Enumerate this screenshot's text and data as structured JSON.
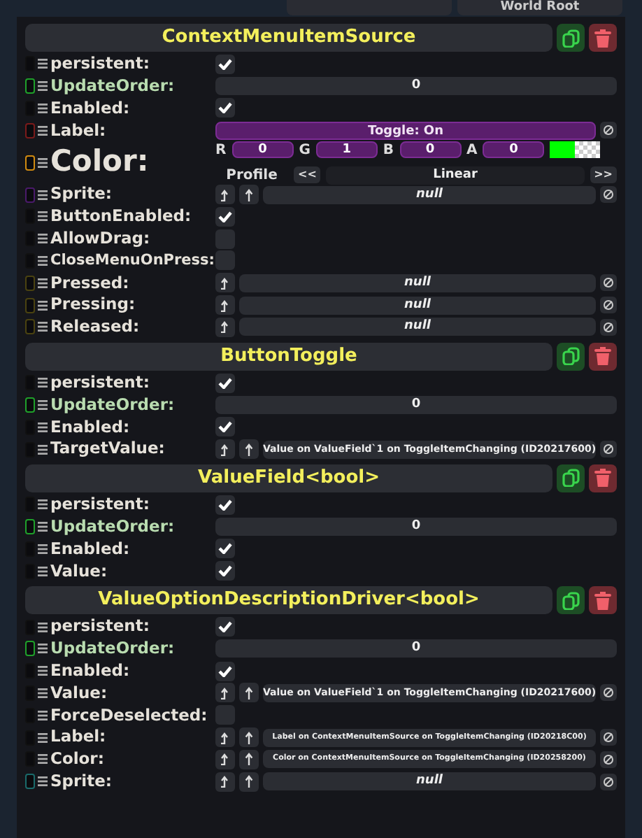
{
  "top_bar": {
    "right_label": "World Root"
  },
  "components": [
    {
      "title": "ContextMenuItemSource",
      "fields": [
        {
          "name": "persistent:",
          "color": "#111111",
          "kind": "check",
          "checked": true
        },
        {
          "name": "UpdateOrder:",
          "color": "#1fa02a",
          "kind": "number",
          "value": "0"
        },
        {
          "name": "Enabled:",
          "color": "#111111",
          "kind": "check",
          "checked": true
        },
        {
          "name": "Label:",
          "color": "#7a1a1a",
          "kind": "text",
          "value": "Toggle: On"
        },
        {
          "name": "Color:",
          "color": "#d08a10",
          "kind": "color",
          "channels": [
            {
              "label": "R",
              "value": "0"
            },
            {
              "label": "G",
              "value": "1"
            },
            {
              "label": "B",
              "value": "0"
            },
            {
              "label": "A",
              "value": "0"
            }
          ],
          "swatch": {
            "color": "#00ff00"
          },
          "profile_label": "Profile",
          "prev": "<<",
          "profile": "Linear",
          "next": ">>"
        },
        {
          "name": "Sprite:",
          "color": "#4a1a6a",
          "kind": "ref",
          "value": "null",
          "is_null": true
        },
        {
          "name": "ButtonEnabled:",
          "color": "#111111",
          "kind": "check",
          "checked": true
        },
        {
          "name": "AllowDrag:",
          "color": "#111111",
          "kind": "check",
          "checked": false
        },
        {
          "name": "CloseMenuOnPress:",
          "color": "#111111",
          "kind": "check",
          "checked": false
        },
        {
          "name": "Pressed:",
          "color": "#4a4210",
          "kind": "delegate",
          "value": "null",
          "is_null": true
        },
        {
          "name": "Pressing:",
          "color": "#4a4210",
          "kind": "delegate",
          "value": "null",
          "is_null": true
        },
        {
          "name": "Released:",
          "color": "#4a4210",
          "kind": "delegate",
          "value": "null",
          "is_null": true
        }
      ]
    },
    {
      "title": "ButtonToggle",
      "fields": [
        {
          "name": "persistent:",
          "color": "#111111",
          "kind": "check",
          "checked": true
        },
        {
          "name": "UpdateOrder:",
          "color": "#1fa02a",
          "kind": "number",
          "value": "0"
        },
        {
          "name": "Enabled:",
          "color": "#111111",
          "kind": "check",
          "checked": true
        },
        {
          "name": "TargetValue:",
          "color": "#111111",
          "kind": "ref",
          "value": "Value on ValueField`1 on ToggleItemChanging (ID20217600)",
          "is_null": false
        }
      ]
    },
    {
      "title": "ValueField<bool>",
      "fields": [
        {
          "name": "persistent:",
          "color": "#111111",
          "kind": "check",
          "checked": true
        },
        {
          "name": "UpdateOrder:",
          "color": "#1fa02a",
          "kind": "number",
          "value": "0"
        },
        {
          "name": "Enabled:",
          "color": "#111111",
          "kind": "check",
          "checked": true
        },
        {
          "name": "Value:",
          "color": "#111111",
          "kind": "check",
          "checked": true
        }
      ]
    },
    {
      "title": "ValueOptionDescriptionDriver<bool>",
      "fields": [
        {
          "name": "persistent:",
          "color": "#111111",
          "kind": "check",
          "checked": true
        },
        {
          "name": "UpdateOrder:",
          "color": "#1fa02a",
          "kind": "number",
          "value": "0"
        },
        {
          "name": "Enabled:",
          "color": "#111111",
          "kind": "check",
          "checked": true
        },
        {
          "name": "Value:",
          "color": "#111111",
          "kind": "ref",
          "value": "Value on ValueField`1 on ToggleItemChanging (ID20217600)",
          "is_null": false
        },
        {
          "name": "ForceDeselected:",
          "color": "#111111",
          "kind": "check",
          "checked": false
        },
        {
          "name": "Label:",
          "color": "#111111",
          "kind": "ref",
          "value": "Label on ContextMenuItemSource on ToggleItemChanging (ID20218C00)",
          "is_null": false
        },
        {
          "name": "Color:",
          "color": "#111111",
          "kind": "ref",
          "value": "Color on ContextMenuItemSource on ToggleItemChanging (ID20258200)",
          "is_null": false
        },
        {
          "name": "Sprite:",
          "color": "#1a6a6a",
          "kind": "ref",
          "value": "null",
          "is_null": true
        }
      ]
    }
  ]
}
